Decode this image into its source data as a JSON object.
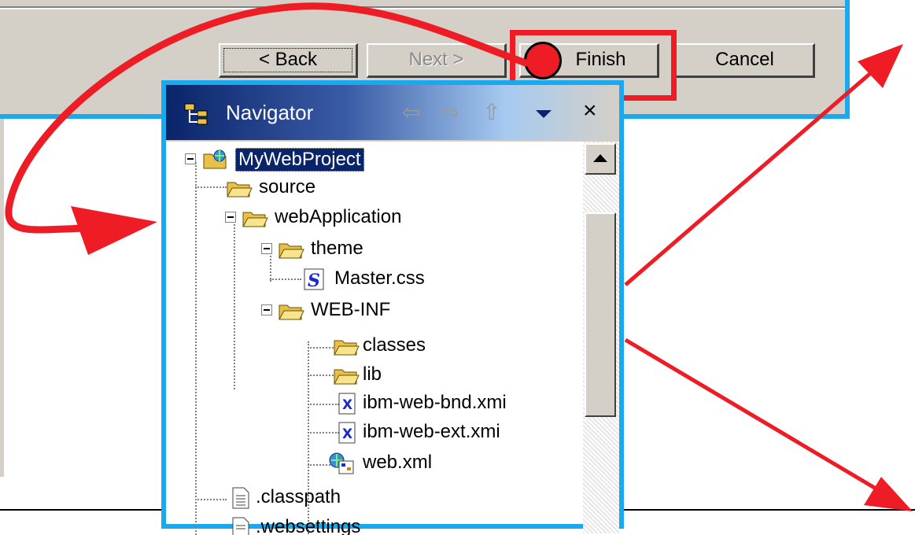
{
  "dialog": {
    "buttons": {
      "back": "< Back",
      "next": "Next >",
      "finish": "Finish",
      "cancel": "Cancel"
    }
  },
  "navigator": {
    "title": "Navigator",
    "toolbar": {
      "back_icon": "left-arrow-icon",
      "forward_icon": "right-arrow-icon",
      "up_icon": "up-arrow-icon",
      "menu_icon": "view-menu-icon",
      "close_glyph": "×"
    },
    "tree": [
      {
        "label": "MyWebProject",
        "icon": "web-project-icon",
        "depth": 0,
        "expanded": true,
        "selected": true
      },
      {
        "label": "source",
        "icon": "folder-icon",
        "depth": 1
      },
      {
        "label": "webApplication",
        "icon": "folder-icon",
        "depth": 1,
        "expanded": true
      },
      {
        "label": "theme",
        "icon": "folder-icon",
        "depth": 2,
        "expanded": true
      },
      {
        "label": "Master.css",
        "icon": "css-file-icon",
        "depth": 3
      },
      {
        "label": "WEB-INF",
        "icon": "folder-icon",
        "depth": 2,
        "expanded": true
      },
      {
        "label": "classes",
        "icon": "folder-icon",
        "depth": 3
      },
      {
        "label": "lib",
        "icon": "folder-icon",
        "depth": 3
      },
      {
        "label": "ibm-web-bnd.xmi",
        "icon": "xmi-file-icon",
        "depth": 3
      },
      {
        "label": "ibm-web-ext.xmi",
        "icon": "xmi-file-icon",
        "depth": 3
      },
      {
        "label": "web.xml",
        "icon": "web-xml-icon",
        "depth": 3
      },
      {
        "label": ".classpath",
        "icon": "text-file-icon",
        "depth": 1
      },
      {
        "label": ".websettings",
        "icon": "text-file-icon",
        "depth": 1
      }
    ]
  },
  "colors": {
    "highlight_blue": "#1aa8ef",
    "annotation_red": "#ee1c24",
    "selection": "#0a246a"
  }
}
